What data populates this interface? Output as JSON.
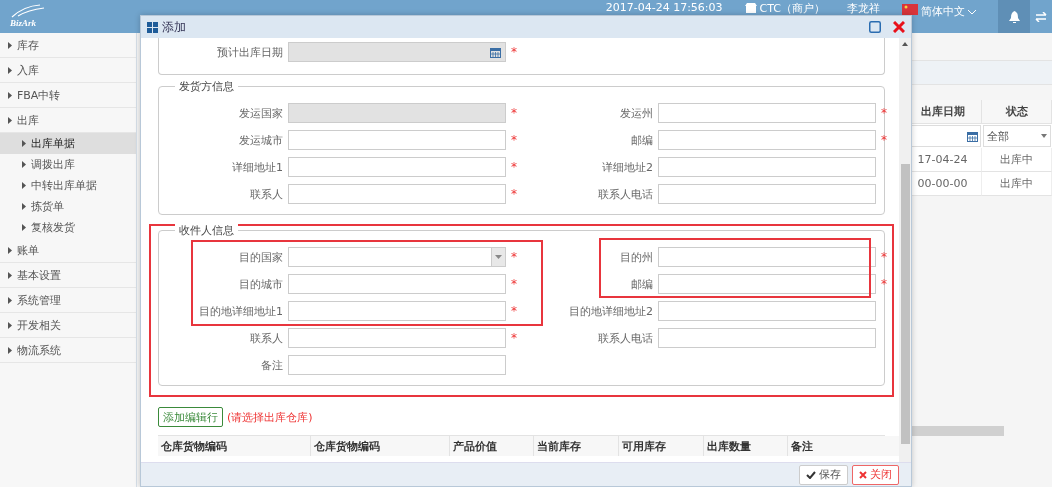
{
  "header": {
    "logo": "BizArk",
    "datetime": "2017-04-24 17:56:03",
    "merchant": "CTC（商户）",
    "user": "李龙祥",
    "language": "简体中文"
  },
  "sidebar": {
    "items": [
      {
        "label": "库存",
        "selected": false
      },
      {
        "label": "入库",
        "selected": false
      },
      {
        "label": "FBA中转",
        "selected": false
      },
      {
        "label": "出库",
        "selected": false,
        "children": [
          {
            "label": "出库单据",
            "selected": true
          },
          {
            "label": "调拨出库",
            "selected": false
          },
          {
            "label": "中转出库单据",
            "selected": false
          },
          {
            "label": "拣货单",
            "selected": false
          },
          {
            "label": "复核发货",
            "selected": false
          }
        ]
      },
      {
        "label": "账单",
        "selected": false
      },
      {
        "label": "基本设置",
        "selected": false
      },
      {
        "label": "系统管理",
        "selected": false
      },
      {
        "label": "开发相关",
        "selected": false
      },
      {
        "label": "物流系统",
        "selected": false
      }
    ]
  },
  "background_table": {
    "columns": [
      "出库日期",
      "状态"
    ],
    "filter_select": "全部",
    "rows": [
      [
        "17-04-24",
        "出库中"
      ],
      [
        "00-00-00",
        "出库中"
      ]
    ]
  },
  "dialog": {
    "title": "添加",
    "sections": [
      {
        "fields": [
          {
            "label": "预计出库日期",
            "kind": "date",
            "disabled": true,
            "required_mark": "*"
          }
        ]
      },
      {
        "legend": "发货方信息",
        "fields": [
          {
            "label": "发运国家",
            "kind": "text",
            "disabled": true,
            "required_mark": "*"
          },
          {
            "label": "发运州",
            "kind": "text",
            "disabled": false,
            "required_mark": "*"
          },
          {
            "label": "发运城市",
            "kind": "text",
            "disabled": false,
            "required_mark": "*"
          },
          {
            "label": "邮编",
            "kind": "text",
            "disabled": false,
            "required_mark": "*"
          },
          {
            "label": "详细地址1",
            "kind": "text",
            "disabled": false,
            "required_mark": "*"
          },
          {
            "label": "详细地址2",
            "kind": "text",
            "disabled": false
          },
          {
            "label": "联系人",
            "kind": "text",
            "disabled": false,
            "required_mark": "*"
          },
          {
            "label": "联系人电话",
            "kind": "text",
            "disabled": false
          }
        ]
      },
      {
        "legend": "收件人信息",
        "annotated": true,
        "fields": [
          {
            "label": "目的国家",
            "kind": "select",
            "disabled": false,
            "required_mark": "*"
          },
          {
            "label": "目的州",
            "kind": "text",
            "disabled": false,
            "required_mark": "*"
          },
          {
            "label": "目的城市",
            "kind": "text",
            "disabled": false,
            "required_mark": "*"
          },
          {
            "label": "邮编",
            "kind": "text",
            "disabled": false,
            "required_mark": "*"
          },
          {
            "label": "目的地详细地址1",
            "kind": "text",
            "disabled": false,
            "required_mark": "*"
          },
          {
            "label": "目的地详细地址2",
            "kind": "text",
            "disabled": false
          },
          {
            "label": "联系人",
            "kind": "text",
            "disabled": false,
            "required_mark": "*"
          },
          {
            "label": "联系人电话",
            "kind": "text",
            "disabled": false
          },
          {
            "label": "备注",
            "kind": "text",
            "disabled": false
          }
        ]
      }
    ],
    "add_row_button": "添加编辑行",
    "hint": "(请选择出库仓库)",
    "table": {
      "columns": [
        "仓库货物编码",
        "仓库货物编码",
        "产品价值",
        "当前库存",
        "可用库存",
        "出库数量",
        "备注"
      ]
    },
    "buttons": [
      {
        "label": "保存",
        "kind": "save"
      },
      {
        "label": "关闭",
        "kind": "close"
      }
    ]
  }
}
